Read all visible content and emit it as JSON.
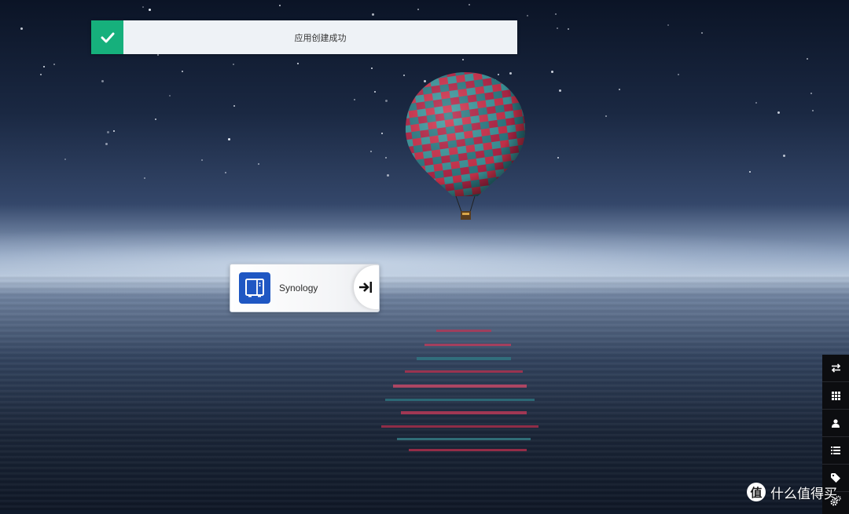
{
  "toast": {
    "message": "应用创建成功",
    "status_icon": "check-icon",
    "accent_color": "#16b07c"
  },
  "app_card": {
    "name": "Synology",
    "icon": "nas-box-icon",
    "icon_color": "#1f57c3",
    "launch_icon": "arrow-to-right-icon"
  },
  "side_toolbar": {
    "items": [
      {
        "icon": "swap-arrows-icon"
      },
      {
        "icon": "grid-icon"
      },
      {
        "icon": "user-icon"
      },
      {
        "icon": "list-icon"
      },
      {
        "icon": "tag-icon"
      },
      {
        "icon": "gears-icon"
      }
    ]
  },
  "watermark": {
    "badge": "值",
    "text": "什么值得买"
  }
}
